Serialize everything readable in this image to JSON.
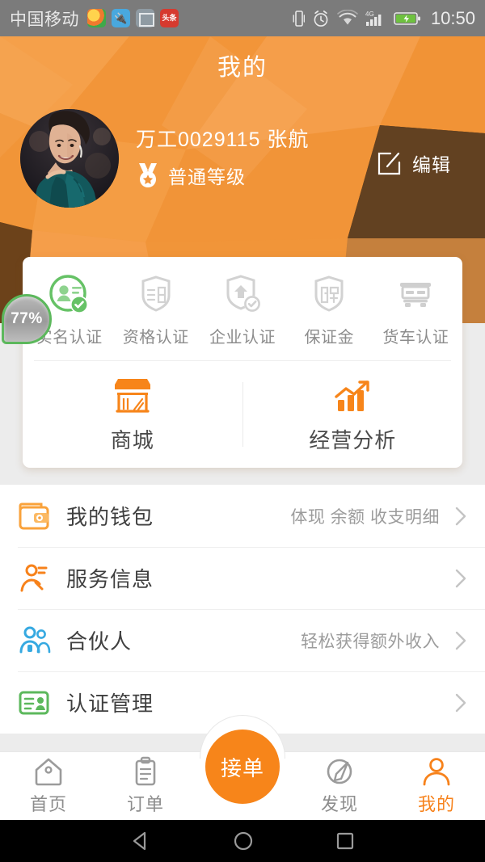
{
  "statusbar": {
    "carrier": "中国移动",
    "time": "10:50",
    "news_icon_text": "头条",
    "icons": [
      "colorful-ball-icon",
      "usb-icon",
      "image-icon",
      "news-icon",
      "vibrate-icon",
      "alarm-icon",
      "wifi-icon",
      "signal-4g-icon",
      "battery-charging-icon"
    ],
    "network": "4G"
  },
  "header": {
    "title": "我的",
    "username": "万工0029115  张航",
    "level": "普通等级",
    "edit_label": "编辑",
    "bg_color": "#f3973d"
  },
  "card": {
    "percent_badge": "77%",
    "certs": [
      {
        "label": "实名认证",
        "state": "active",
        "color": "#66c266"
      },
      {
        "label": "资格认证",
        "state": "inactive",
        "color": "#cccccc"
      },
      {
        "label": "企业认证",
        "state": "inactive",
        "color": "#cccccc"
      },
      {
        "label": "保证金",
        "state": "inactive",
        "color": "#cccccc"
      },
      {
        "label": "货车认证",
        "state": "inactive",
        "color": "#cccccc"
      }
    ],
    "shortcuts": [
      {
        "label": "商城",
        "icon": "shop-icon",
        "color": "#f7851a"
      },
      {
        "label": "经营分析",
        "icon": "chart-up-icon",
        "color": "#f7851a"
      }
    ]
  },
  "menu": {
    "rows": [
      {
        "label": "我的钱包",
        "sub": "体现 余额 收支明细",
        "icon": "wallet-icon",
        "color": "#f9a23b"
      },
      {
        "label": "服务信息",
        "sub": "",
        "icon": "service-worker-icon",
        "color": "#f7821b"
      },
      {
        "label": "合伙人",
        "sub": "轻松获得额外收入",
        "icon": "partners-icon",
        "color": "#36a9e1"
      },
      {
        "label": "认证管理",
        "sub": "",
        "icon": "id-card-icon",
        "color": "#5cb85c"
      }
    ]
  },
  "tabbar": {
    "items": [
      {
        "label": "首页",
        "icon": "home-icon",
        "active": false
      },
      {
        "label": "订单",
        "icon": "order-clipboard-icon",
        "active": false
      },
      {
        "label": "接单",
        "icon": "accept-order-fab",
        "active": false
      },
      {
        "label": "发现",
        "icon": "discover-compass-icon",
        "active": false
      },
      {
        "label": "我的",
        "icon": "user-icon",
        "active": true
      }
    ],
    "fab_label": "接单",
    "active_color": "#f7821b",
    "inactive_color": "#8d8d8d"
  },
  "androidnav": {
    "buttons": [
      "back-icon",
      "home-icon",
      "recents-icon"
    ]
  }
}
